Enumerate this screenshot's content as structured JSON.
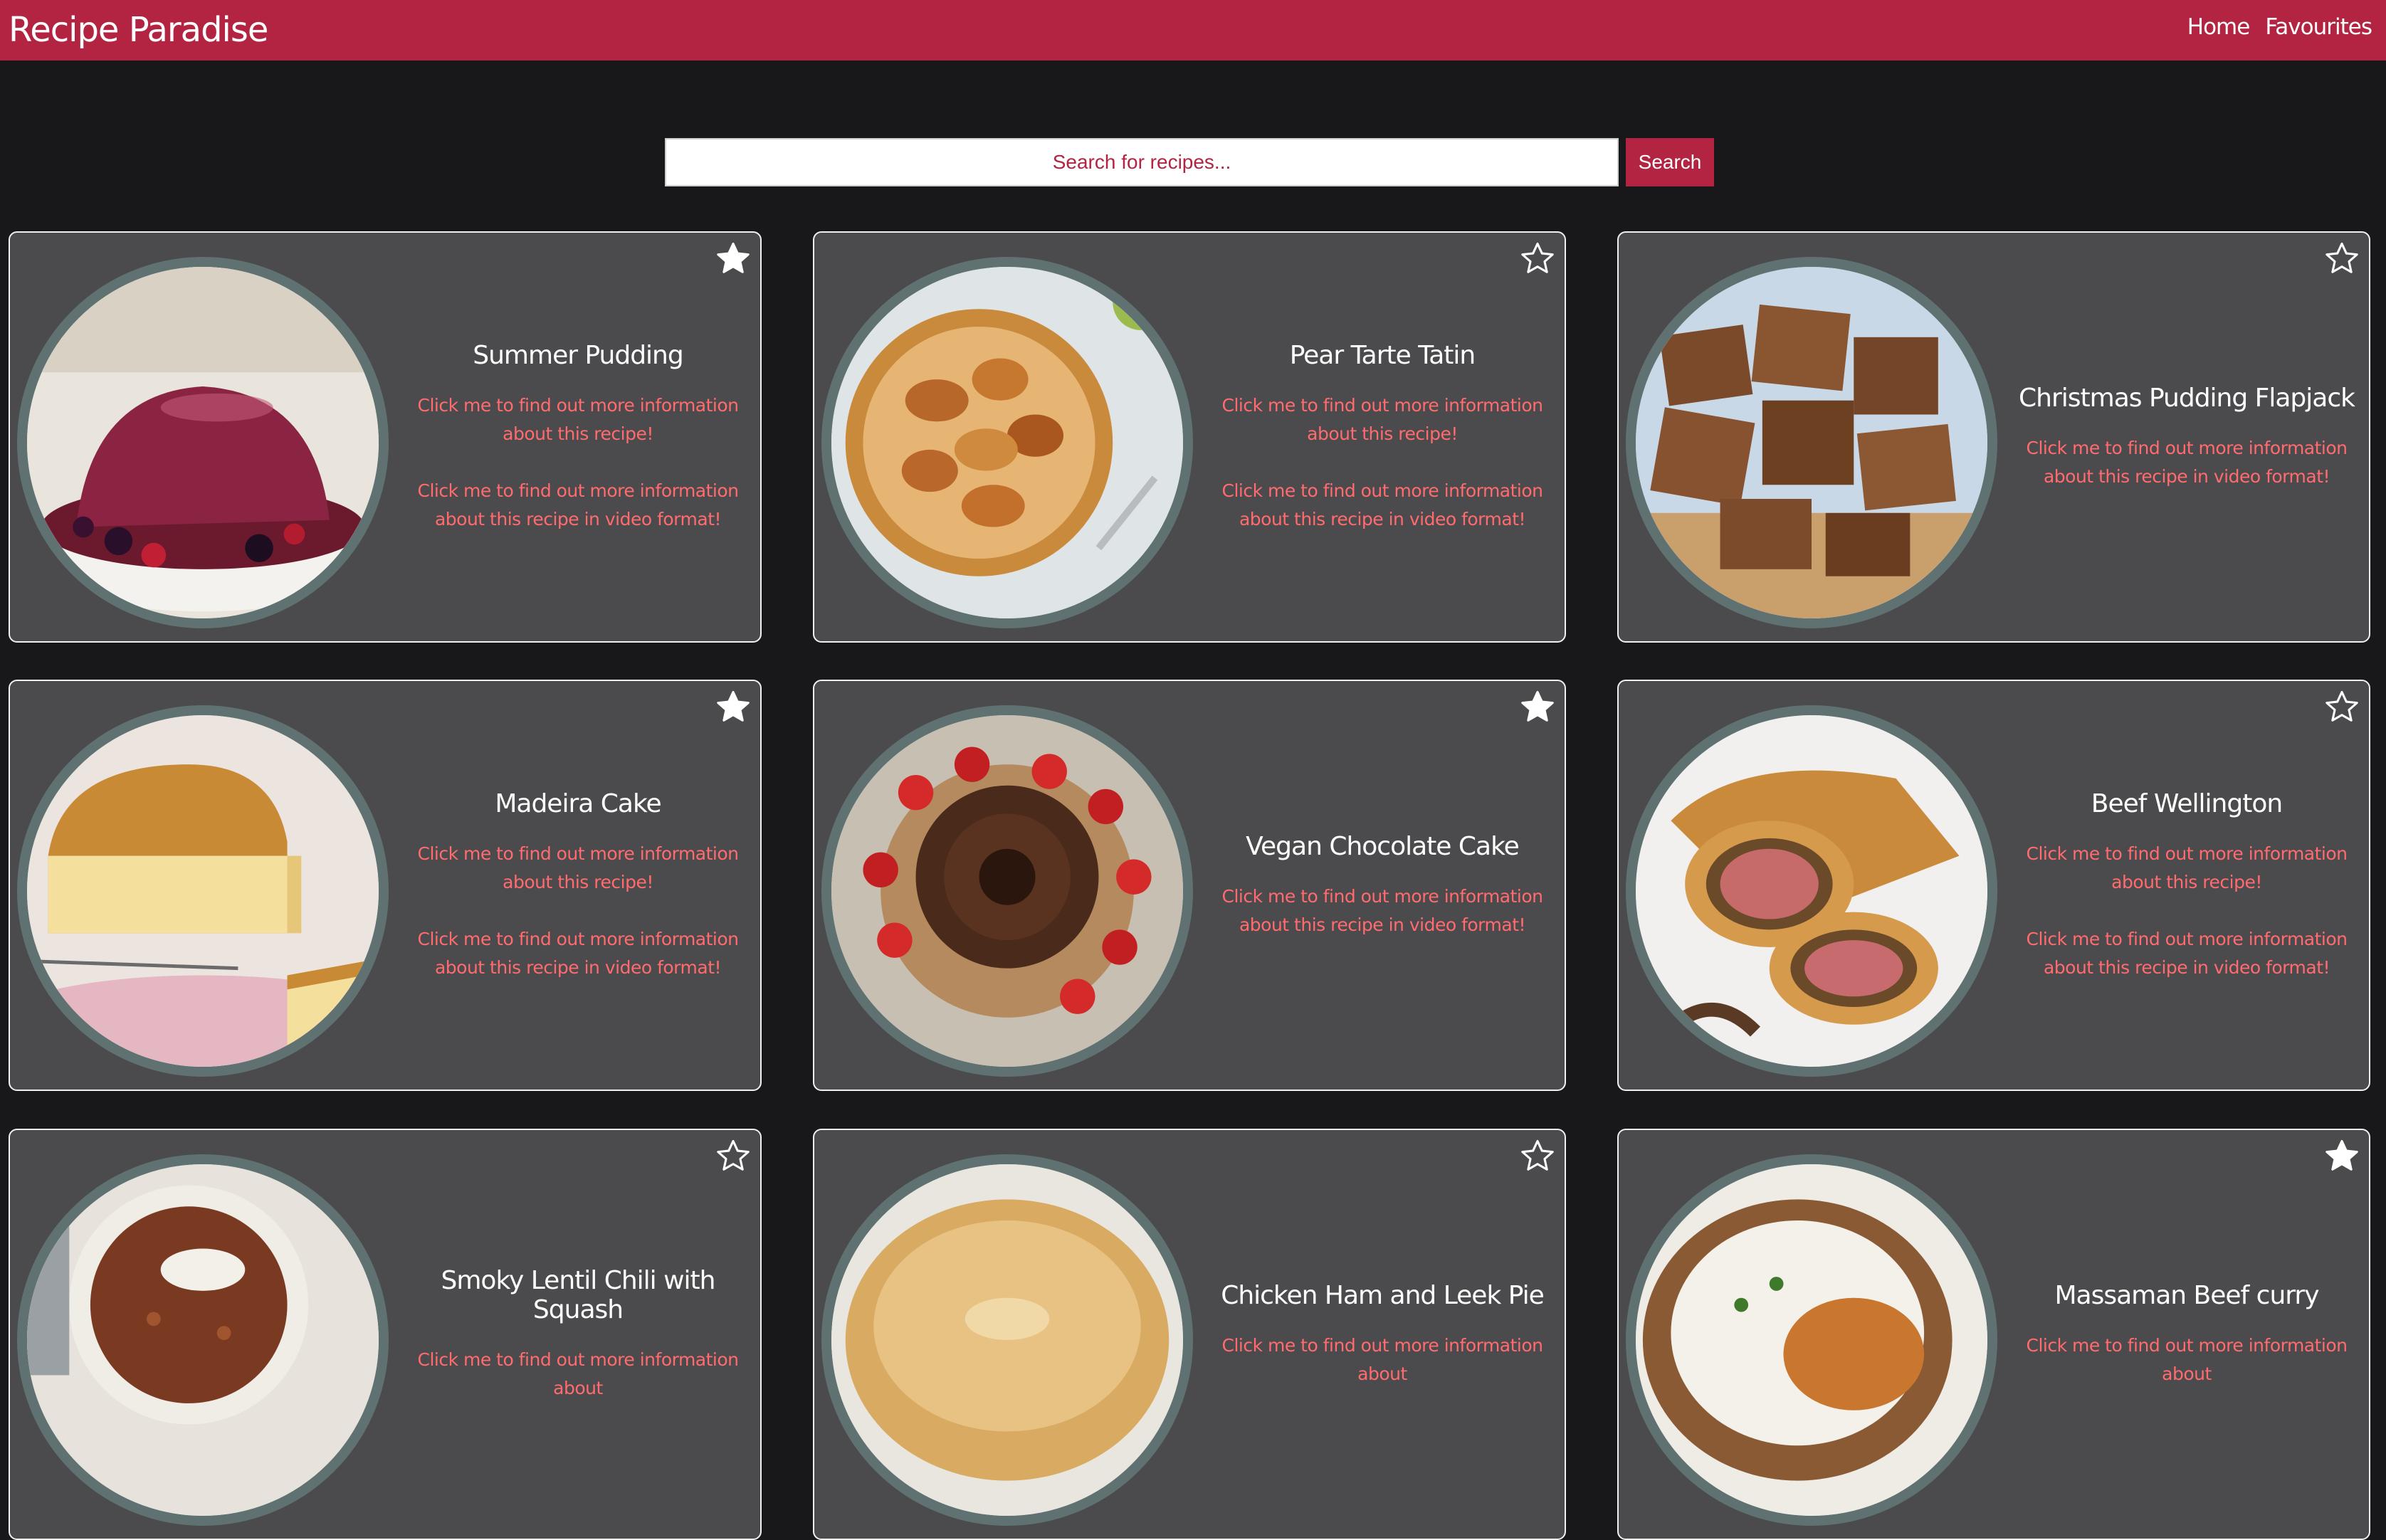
{
  "app": {
    "title": "Recipe Paradise",
    "nav": [
      {
        "label": "Home"
      },
      {
        "label": "Favourites"
      }
    ]
  },
  "search": {
    "placeholder": "Search for recipes...",
    "button_label": "Search"
  },
  "colors": {
    "brand": "#b22442",
    "background": "#18181b",
    "card": "#4b4b4d",
    "link": "#ff6b6e",
    "image_ring": "#5f7271"
  },
  "recipes": [
    {
      "title": "Summer Pudding",
      "info_link": "Click me to find out more information about this recipe!",
      "video_link": "Click me to find out more information about this recipe in video format!",
      "favourite": true,
      "image": "summer-pudding-photo"
    },
    {
      "title": "Pear Tarte Tatin",
      "info_link": "Click me to find out more information about this recipe!",
      "video_link": "Click me to find out more information about this recipe in video format!",
      "favourite": false,
      "image": "pear-tarte-tatin-photo"
    },
    {
      "title": "Christmas Pudding Flapjack",
      "info_link": "",
      "video_link": "Click me to find out more information about this recipe in video format!",
      "favourite": false,
      "image": "christmas-pudding-flapjack-photo"
    },
    {
      "title": "Madeira Cake",
      "info_link": "Click me to find out more information about this recipe!",
      "video_link": "Click me to find out more information about this recipe in video format!",
      "favourite": true,
      "image": "madeira-cake-photo"
    },
    {
      "title": "Vegan Chocolate Cake",
      "info_link": "",
      "video_link": "Click me to find out more information about this recipe in video format!",
      "favourite": true,
      "image": "vegan-chocolate-cake-photo"
    },
    {
      "title": "Beef Wellington",
      "info_link": "Click me to find out more information about this recipe!",
      "video_link": "Click me to find out more information about this recipe in video format!",
      "favourite": false,
      "image": "beef-wellington-photo"
    },
    {
      "title": "Smoky Lentil Chili with Squash",
      "info_link": "Click me to find out more information about",
      "video_link": "",
      "favourite": false,
      "image": "smoky-lentil-chili-photo"
    },
    {
      "title": "Chicken Ham and Leek Pie",
      "info_link": "Click me to find out more information about",
      "video_link": "",
      "favourite": false,
      "image": "chicken-ham-leek-pie-photo"
    },
    {
      "title": "Massaman Beef curry",
      "info_link": "Click me to find out more information about",
      "video_link": "",
      "favourite": true,
      "image": "massaman-beef-curry-photo"
    }
  ]
}
